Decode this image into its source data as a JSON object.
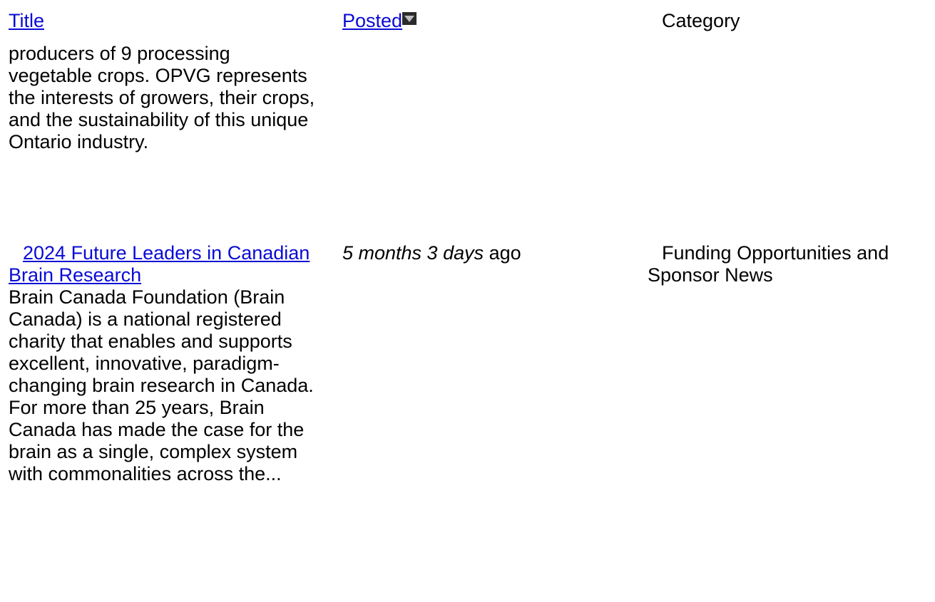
{
  "table": {
    "headers": {
      "title": "Title",
      "posted": "Posted",
      "category": "Category"
    },
    "sort_icon": "sort-descending-icon",
    "rows": [
      {
        "description": "producers of 9 processing vegetable crops. OPVG represents the interests of growers, their crops, and the sustainability of this unique Ontario industry."
      },
      {
        "title": "2024 Future Leaders in Canadian Brain Research",
        "posted_italic": "5 months 3 days",
        "posted_suffix": " ago",
        "category": "Funding Opportunities and Sponsor News",
        "description": "Brain Canada Foundation (Brain Canada) is a national registered charity that enables and supports excellent, innovative, paradigm-changing brain research in Canada. For more than 25 years, Brain Canada has made the case for the brain as a single, complex system with commonalities across the..."
      }
    ]
  }
}
